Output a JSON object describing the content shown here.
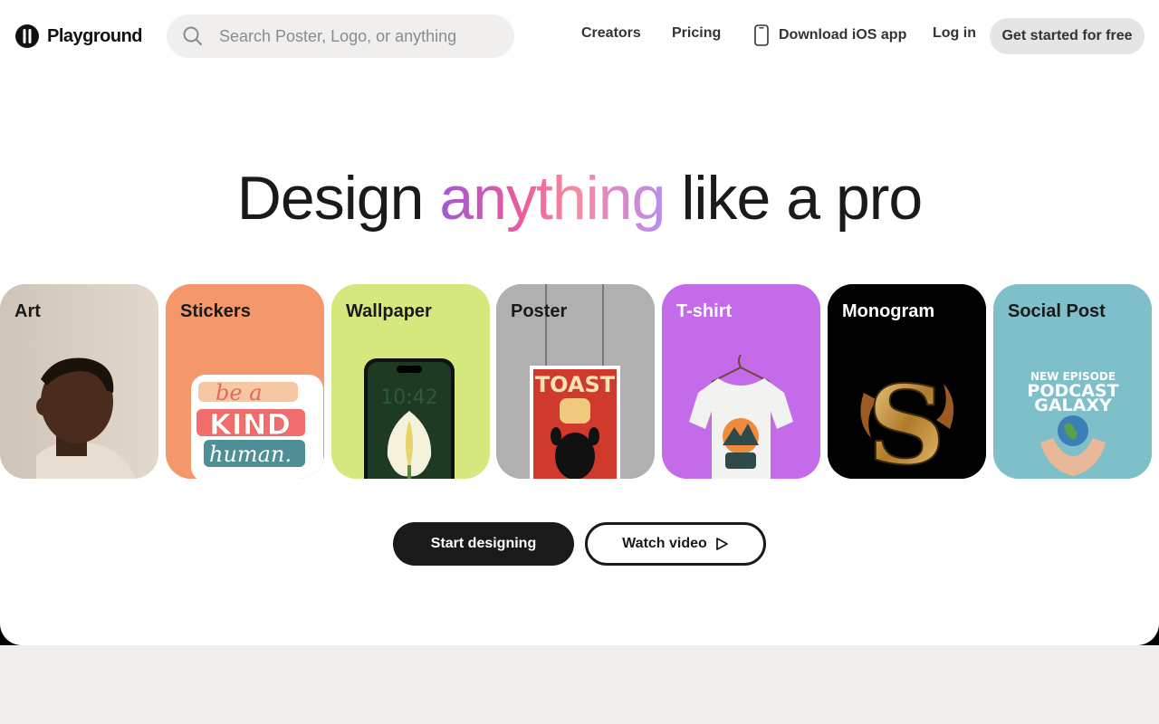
{
  "brand": {
    "name": "Playground"
  },
  "search": {
    "placeholder": "Search Poster, Logo, or anything"
  },
  "nav": {
    "creators": "Creators",
    "pricing": "Pricing",
    "ios": "Download iOS app",
    "login": "Log in",
    "cta": "Get started for free"
  },
  "hero": {
    "title_pre": "Design ",
    "title_highlight": "anything",
    "title_post": " like a pro"
  },
  "cards": [
    {
      "label": "Art",
      "bg": "#d6ccc0"
    },
    {
      "label": "Stickers",
      "bg": "#f4976a",
      "art_text": [
        "be a",
        "KIND",
        "human."
      ]
    },
    {
      "label": "Wallpaper",
      "bg": "#d4e87e",
      "art_text": [
        "10:42"
      ]
    },
    {
      "label": "Poster",
      "bg": "#b0b0b0",
      "art_text": [
        "TOAST"
      ]
    },
    {
      "label": "T-shirt",
      "bg": "#c46bea"
    },
    {
      "label": "Monogram",
      "bg": "#000000",
      "art_text": [
        "S"
      ]
    },
    {
      "label": "Social Post",
      "bg": "#7ebfca",
      "art_text": [
        "NEW EPISODE",
        "PODCAST",
        "GALAXY"
      ]
    }
  ],
  "buttons": {
    "start": "Start designing",
    "watch": "Watch video"
  },
  "icons": [
    "playground-logo-icon",
    "search-icon",
    "phone-icon",
    "play-icon"
  ],
  "colors": {
    "primary": "#1a1a1a",
    "surface": "#f0efed",
    "accent_gradient": [
      "#a05ad4",
      "#e95a9b",
      "#f98a9e",
      "#b98bf2"
    ]
  }
}
